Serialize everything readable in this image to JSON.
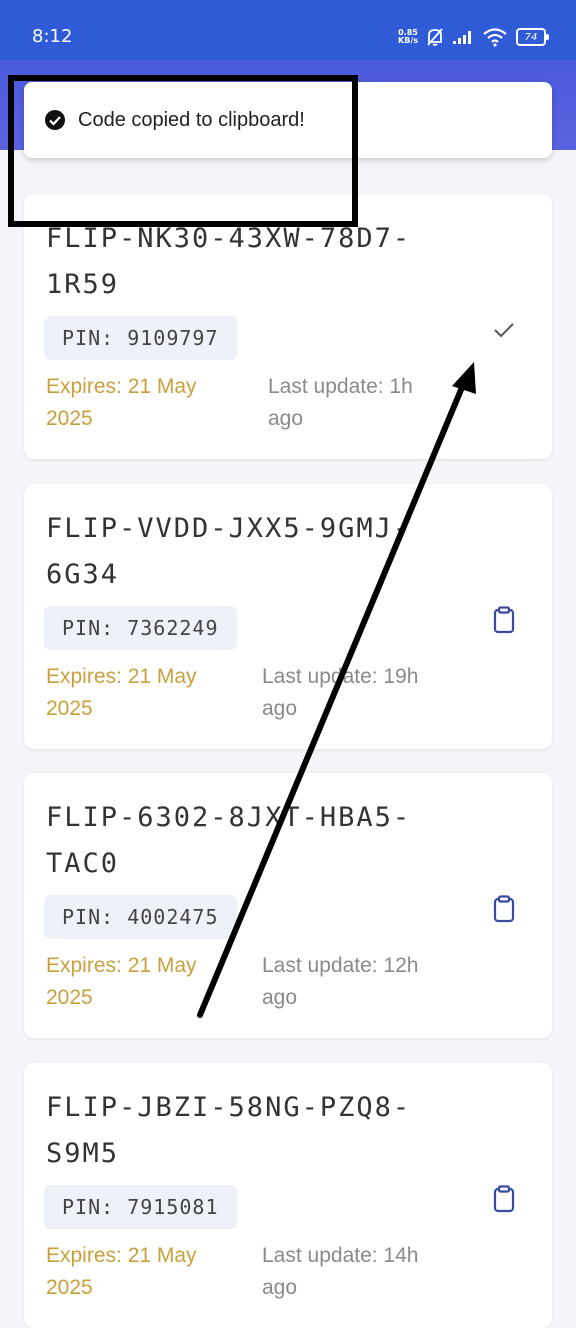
{
  "status": {
    "time": "8:12",
    "net_speed_value": "0.85",
    "net_speed_unit": "KB/s",
    "battery": "74"
  },
  "toast": {
    "message": "Code copied to clipboard!"
  },
  "cards": [
    {
      "code_line1": "FLIP-NK30-43XW-78D7-",
      "code_line2": "1R59",
      "pin": "PIN: 9109797",
      "expires_line1": "Expires: 21 May",
      "expires_line2": "2025",
      "updated_line1": "Last update: 1h",
      "updated_line2": "ago",
      "action_icon": "check-icon"
    },
    {
      "code_line1": "FLIP-VVDD-JXX5-9GMJ-",
      "code_line2": "6G34",
      "pin": "PIN: 7362249",
      "expires_line1": "Expires: 21 May",
      "expires_line2": "2025",
      "updated_line1": "Last update: 19h",
      "updated_line2": "ago",
      "action_icon": "clipboard-icon"
    },
    {
      "code_line1": "FLIP-6302-8JXT-HBA5-",
      "code_line2": "TAC0",
      "pin": "PIN: 4002475",
      "expires_line1": "Expires: 21 May",
      "expires_line2": "2025",
      "updated_line1": "Last update: 12h",
      "updated_line2": "ago",
      "action_icon": "clipboard-icon"
    },
    {
      "code_line1": "FLIP-JBZI-58NG-PZQ8-",
      "code_line2": "S9M5",
      "pin": "PIN: 7915081",
      "expires_line1": "Expires: 21 May",
      "expires_line2": "2025",
      "updated_line1": "Last update: 14h",
      "updated_line2": "ago",
      "action_icon": "clipboard-icon"
    }
  ],
  "colors": {
    "header": "#2f5bd6",
    "band": "#5a62e0",
    "expires": "#c9a03c",
    "muted": "#8a8a8a",
    "icon": "#3b4a9e"
  }
}
